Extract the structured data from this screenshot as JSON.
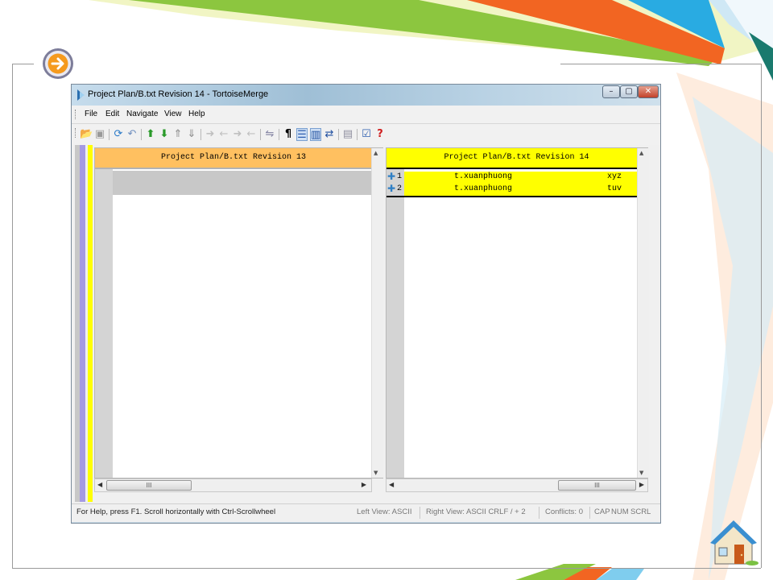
{
  "window": {
    "title": "Project Plan/B.txt Revision 14 - TortoiseMerge",
    "controls": {
      "minimize": "–",
      "maximize": "▢",
      "close": "✕"
    }
  },
  "menu": [
    "File",
    "Edit",
    "Navigate",
    "View",
    "Help"
  ],
  "toolbar": {
    "icons": [
      "open-icon",
      "save-icon",
      "reload-icon",
      "undo-icon",
      "next-diff-icon",
      "prev-diff-icon",
      "next-conflict-icon",
      "prev-conflict-icon",
      "use-left-block-icon",
      "use-right-block-icon",
      "use-left-then-right-icon",
      "use-right-then-left-icon",
      "use-both-icon",
      "whitespace-icon",
      "one-pane-view-icon",
      "two-pane-view-icon",
      "switch-views-icon",
      "locator-bar-icon",
      "mark-resolved-icon",
      "help-icon"
    ]
  },
  "left_pane": {
    "header": "Project Plan/B.txt Revision 13",
    "lines": []
  },
  "right_pane": {
    "header": "Project Plan/B.txt Revision 14",
    "lines": [
      {
        "number": "1",
        "author": "t.xuanphuong",
        "text": "xyz"
      },
      {
        "number": "2",
        "author": "t.xuanphuong",
        "text": "tuv"
      }
    ]
  },
  "scrollbar": {
    "thumb_grip": "III"
  },
  "status": {
    "help": "For Help, press F1. Scroll horizontally with Ctrl-Scrollwheel",
    "left_view": "Left View: ASCII",
    "right_view": "Right View: ASCII CRLF  / + 2",
    "conflicts": "Conflicts: 0",
    "cap": "CAP",
    "num": "NUM",
    "scrl": "SCRL"
  },
  "colors": {
    "added_line": "#ffff00",
    "left_header": "#ffc060",
    "locator_purple": "#a59ae3",
    "brand_orange": "#f26522",
    "brand_green": "#8cc63f",
    "brand_blue": "#29abe2"
  }
}
